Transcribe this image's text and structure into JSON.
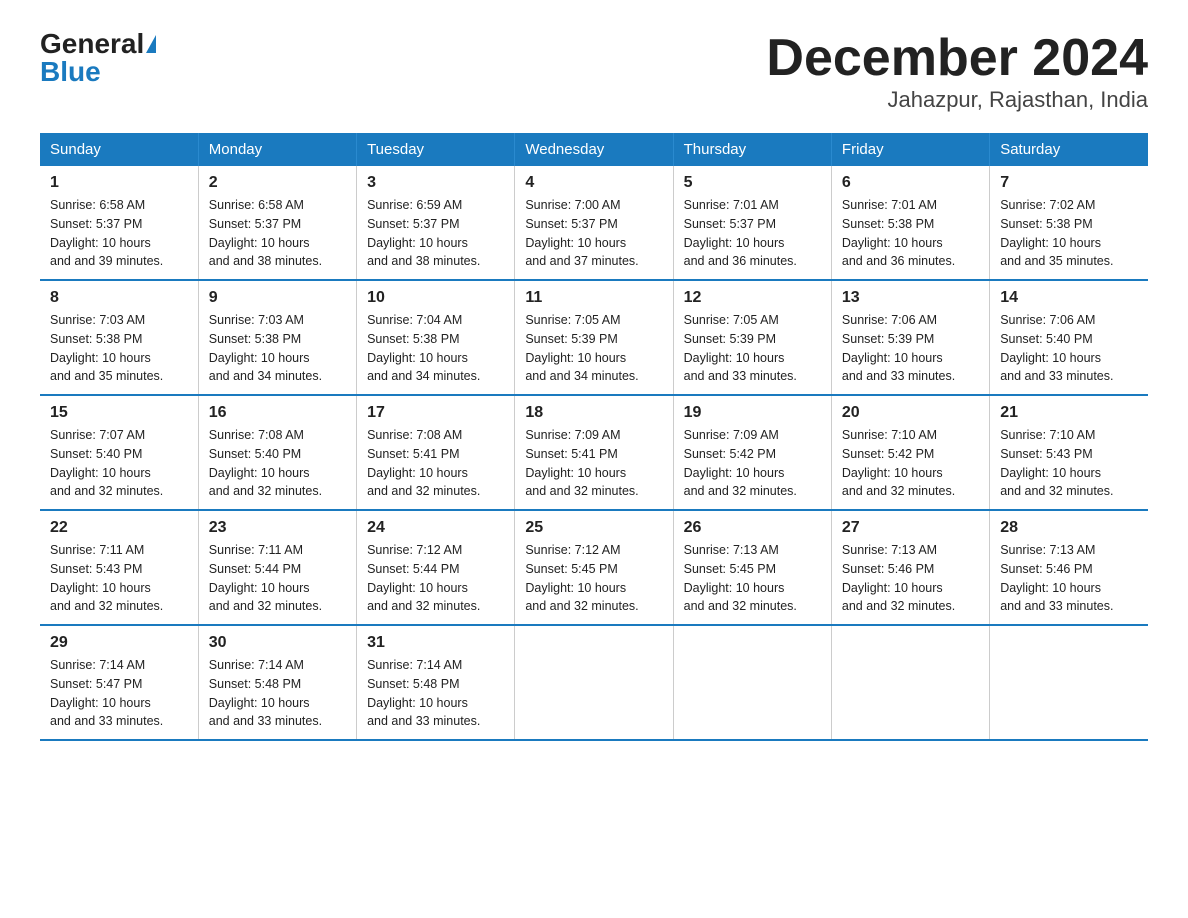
{
  "header": {
    "logo_general": "General",
    "logo_blue": "Blue",
    "title": "December 2024",
    "subtitle": "Jahazpur, Rajasthan, India"
  },
  "days_of_week": [
    "Sunday",
    "Monday",
    "Tuesday",
    "Wednesday",
    "Thursday",
    "Friday",
    "Saturday"
  ],
  "weeks": [
    [
      {
        "day": "1",
        "sunrise": "6:58 AM",
        "sunset": "5:37 PM",
        "daylight": "10 hours and 39 minutes."
      },
      {
        "day": "2",
        "sunrise": "6:58 AM",
        "sunset": "5:37 PM",
        "daylight": "10 hours and 38 minutes."
      },
      {
        "day": "3",
        "sunrise": "6:59 AM",
        "sunset": "5:37 PM",
        "daylight": "10 hours and 38 minutes."
      },
      {
        "day": "4",
        "sunrise": "7:00 AM",
        "sunset": "5:37 PM",
        "daylight": "10 hours and 37 minutes."
      },
      {
        "day": "5",
        "sunrise": "7:01 AM",
        "sunset": "5:37 PM",
        "daylight": "10 hours and 36 minutes."
      },
      {
        "day": "6",
        "sunrise": "7:01 AM",
        "sunset": "5:38 PM",
        "daylight": "10 hours and 36 minutes."
      },
      {
        "day": "7",
        "sunrise": "7:02 AM",
        "sunset": "5:38 PM",
        "daylight": "10 hours and 35 minutes."
      }
    ],
    [
      {
        "day": "8",
        "sunrise": "7:03 AM",
        "sunset": "5:38 PM",
        "daylight": "10 hours and 35 minutes."
      },
      {
        "day": "9",
        "sunrise": "7:03 AM",
        "sunset": "5:38 PM",
        "daylight": "10 hours and 34 minutes."
      },
      {
        "day": "10",
        "sunrise": "7:04 AM",
        "sunset": "5:38 PM",
        "daylight": "10 hours and 34 minutes."
      },
      {
        "day": "11",
        "sunrise": "7:05 AM",
        "sunset": "5:39 PM",
        "daylight": "10 hours and 34 minutes."
      },
      {
        "day": "12",
        "sunrise": "7:05 AM",
        "sunset": "5:39 PM",
        "daylight": "10 hours and 33 minutes."
      },
      {
        "day": "13",
        "sunrise": "7:06 AM",
        "sunset": "5:39 PM",
        "daylight": "10 hours and 33 minutes."
      },
      {
        "day": "14",
        "sunrise": "7:06 AM",
        "sunset": "5:40 PM",
        "daylight": "10 hours and 33 minutes."
      }
    ],
    [
      {
        "day": "15",
        "sunrise": "7:07 AM",
        "sunset": "5:40 PM",
        "daylight": "10 hours and 32 minutes."
      },
      {
        "day": "16",
        "sunrise": "7:08 AM",
        "sunset": "5:40 PM",
        "daylight": "10 hours and 32 minutes."
      },
      {
        "day": "17",
        "sunrise": "7:08 AM",
        "sunset": "5:41 PM",
        "daylight": "10 hours and 32 minutes."
      },
      {
        "day": "18",
        "sunrise": "7:09 AM",
        "sunset": "5:41 PM",
        "daylight": "10 hours and 32 minutes."
      },
      {
        "day": "19",
        "sunrise": "7:09 AM",
        "sunset": "5:42 PM",
        "daylight": "10 hours and 32 minutes."
      },
      {
        "day": "20",
        "sunrise": "7:10 AM",
        "sunset": "5:42 PM",
        "daylight": "10 hours and 32 minutes."
      },
      {
        "day": "21",
        "sunrise": "7:10 AM",
        "sunset": "5:43 PM",
        "daylight": "10 hours and 32 minutes."
      }
    ],
    [
      {
        "day": "22",
        "sunrise": "7:11 AM",
        "sunset": "5:43 PM",
        "daylight": "10 hours and 32 minutes."
      },
      {
        "day": "23",
        "sunrise": "7:11 AM",
        "sunset": "5:44 PM",
        "daylight": "10 hours and 32 minutes."
      },
      {
        "day": "24",
        "sunrise": "7:12 AM",
        "sunset": "5:44 PM",
        "daylight": "10 hours and 32 minutes."
      },
      {
        "day": "25",
        "sunrise": "7:12 AM",
        "sunset": "5:45 PM",
        "daylight": "10 hours and 32 minutes."
      },
      {
        "day": "26",
        "sunrise": "7:13 AM",
        "sunset": "5:45 PM",
        "daylight": "10 hours and 32 minutes."
      },
      {
        "day": "27",
        "sunrise": "7:13 AM",
        "sunset": "5:46 PM",
        "daylight": "10 hours and 32 minutes."
      },
      {
        "day": "28",
        "sunrise": "7:13 AM",
        "sunset": "5:46 PM",
        "daylight": "10 hours and 33 minutes."
      }
    ],
    [
      {
        "day": "29",
        "sunrise": "7:14 AM",
        "sunset": "5:47 PM",
        "daylight": "10 hours and 33 minutes."
      },
      {
        "day": "30",
        "sunrise": "7:14 AM",
        "sunset": "5:48 PM",
        "daylight": "10 hours and 33 minutes."
      },
      {
        "day": "31",
        "sunrise": "7:14 AM",
        "sunset": "5:48 PM",
        "daylight": "10 hours and 33 minutes."
      },
      null,
      null,
      null,
      null
    ]
  ],
  "labels": {
    "sunrise": "Sunrise:",
    "sunset": "Sunset:",
    "daylight": "Daylight:"
  }
}
